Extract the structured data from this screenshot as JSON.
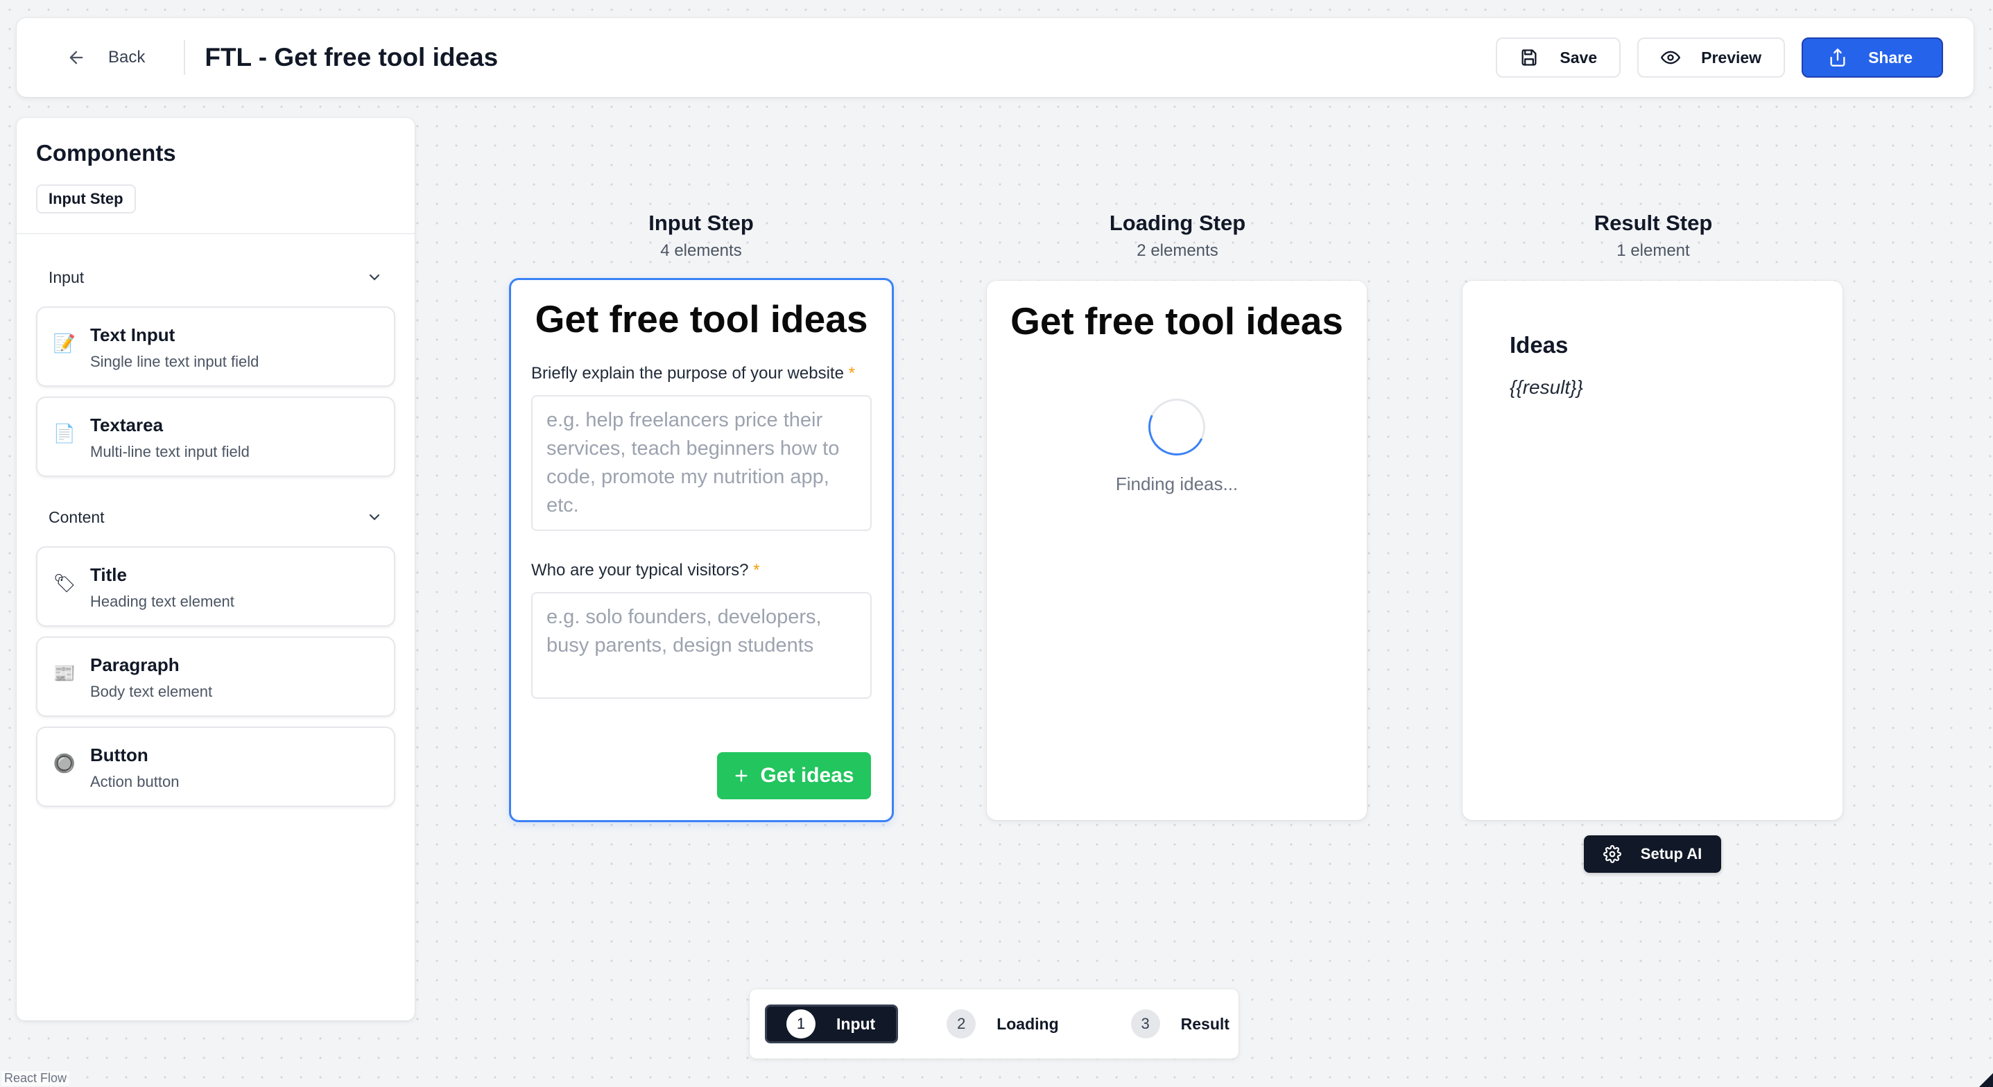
{
  "topbar": {
    "back_label": "Back",
    "title": "FTL - Get free tool ideas",
    "save_label": "Save",
    "preview_label": "Preview",
    "share_label": "Share"
  },
  "sidebar": {
    "title": "Components",
    "active_step": "Input Step",
    "sections": [
      {
        "label": "Input",
        "items": [
          {
            "name": "Text Input",
            "desc": "Single line text input field",
            "icon": "memo-icon"
          },
          {
            "name": "Textarea",
            "desc": "Multi-line text input field",
            "icon": "document-icon"
          }
        ]
      },
      {
        "label": "Content",
        "items": [
          {
            "name": "Title",
            "desc": "Heading text element",
            "icon": "label-tag-icon"
          },
          {
            "name": "Paragraph",
            "desc": "Body text element",
            "icon": "newspaper-icon"
          },
          {
            "name": "Button",
            "desc": "Action button",
            "icon": "radio-button-icon"
          }
        ]
      }
    ]
  },
  "steps": {
    "input": {
      "heading": "Input Step",
      "count": "4 elements",
      "card_title": "Get free tool ideas",
      "field1_label": "Briefly explain the purpose of your website",
      "field1_placeholder": "e.g. help freelancers price their services, teach beginners how to code, promote my nutrition app, etc.",
      "field2_label": "Who are your typical visitors?",
      "field2_placeholder": "e.g. solo founders, developers, busy parents, design students",
      "required_mark": "*",
      "button_label": "Get ideas"
    },
    "loading": {
      "heading": "Loading Step",
      "count": "2 elements",
      "card_title": "Get free tool ideas",
      "loading_text": "Finding ideas..."
    },
    "result": {
      "heading": "Result Step",
      "count": "1 element",
      "result_heading": "Ideas",
      "result_placeholder": "{{result}}"
    }
  },
  "setup_ai_label": "Setup AI",
  "stepper": [
    {
      "num": "1",
      "label": "Input",
      "active": true
    },
    {
      "num": "2",
      "label": "Loading",
      "active": false
    },
    {
      "num": "3",
      "label": "Result",
      "active": false
    }
  ],
  "attribution": "React Flow",
  "colors": {
    "primary": "#2563eb",
    "success": "#22c55e",
    "dark": "#111827",
    "selected_border": "#3b82f6",
    "required": "#f59e0b"
  }
}
